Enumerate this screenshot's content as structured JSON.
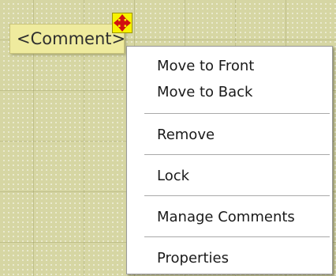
{
  "comment": {
    "text": "<Comment>",
    "move_icon": "move-arrows-icon"
  },
  "context_menu": {
    "items": [
      {
        "label": "Move to Front"
      },
      {
        "label": "Move to Back"
      },
      {
        "label": "Remove"
      },
      {
        "label": "Lock"
      },
      {
        "label": "Manage Comments"
      },
      {
        "label": "Properties"
      }
    ]
  },
  "colors": {
    "canvas_background": "#d6d6a3",
    "comment_fill": "#efeb9e",
    "handle_fill": "#f7f200",
    "handle_arrow": "#d01010",
    "menu_background": "#ffffff"
  }
}
